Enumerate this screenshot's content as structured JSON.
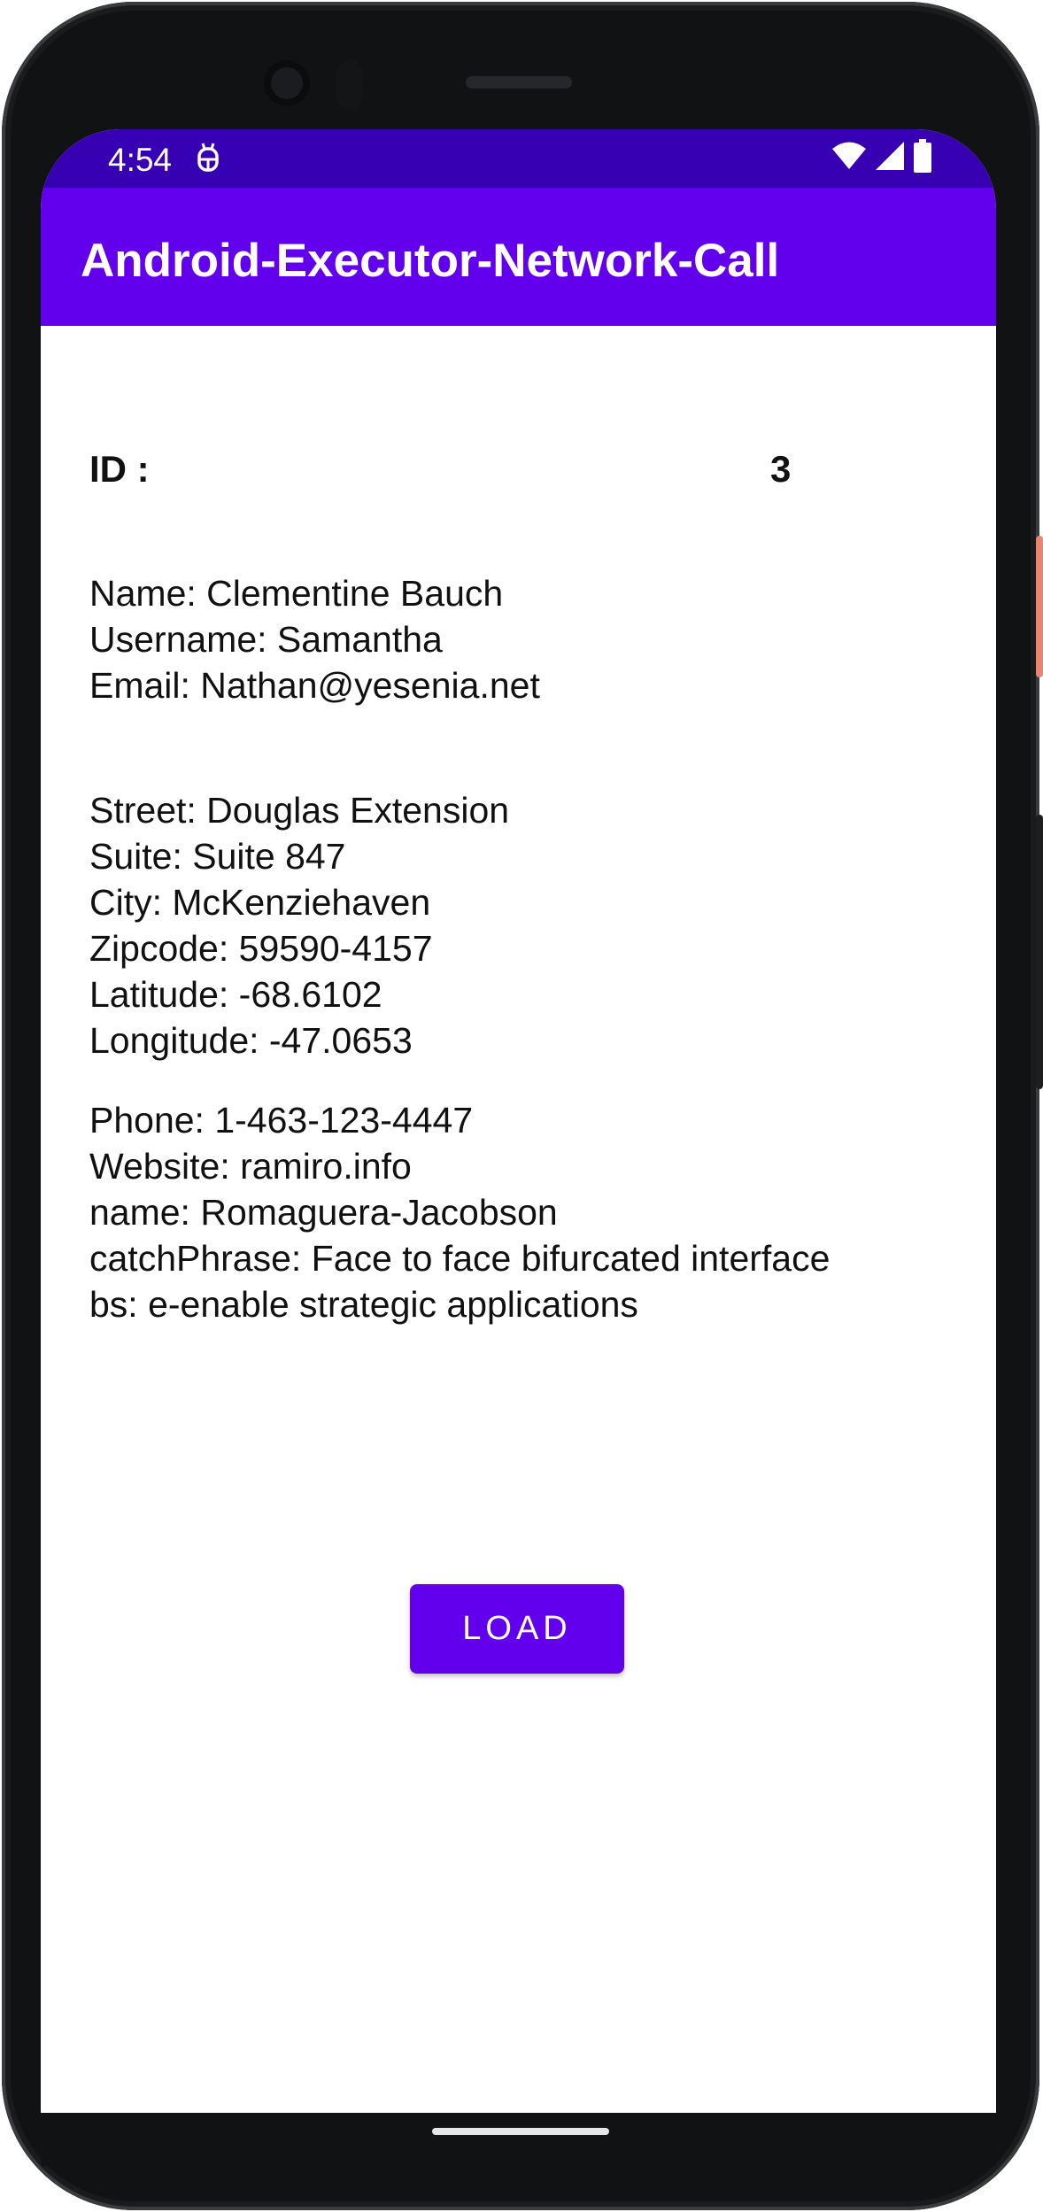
{
  "status_bar": {
    "time": "4:54",
    "left_icon": "android-debug-icon",
    "right_icons": [
      "wifi-icon",
      "signal-icon",
      "battery-icon"
    ],
    "color": "#3700b3"
  },
  "app_bar": {
    "title": "Android-Executor-Network-Call",
    "color": "#6200ee"
  },
  "record": {
    "id_label": "ID :",
    "id_value": "3",
    "user": {
      "name": "Name: Clementine Bauch",
      "username": "Username: Samantha",
      "email": "Email: Nathan@yesenia.net"
    },
    "address": {
      "street": "Street: Douglas Extension",
      "suite": "Suite: Suite 847",
      "city": "City: McKenziehaven",
      "zipcode": "Zipcode: 59590-4157",
      "latitude": "Latitude: -68.6102",
      "longitude": "Longitude: -47.0653"
    },
    "company": {
      "phone": "Phone: 1-463-123-4447",
      "website": "Website: ramiro.info",
      "name": "name: Romaguera-Jacobson",
      "catch_phrase": "catchPhrase: Face to face bifurcated interface",
      "bs": "bs: e-enable strategic applications"
    }
  },
  "actions": {
    "load_label": "LOAD",
    "button_color": "#6200ee"
  }
}
